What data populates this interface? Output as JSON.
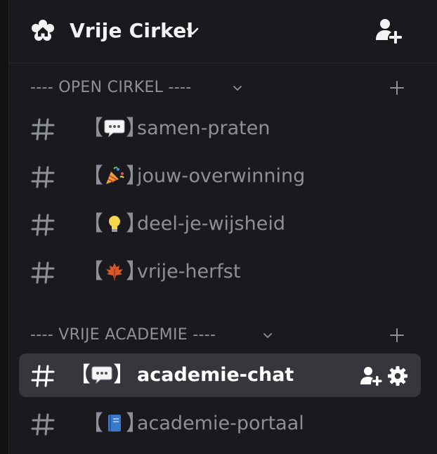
{
  "server": {
    "name": "Vrije Cirkel",
    "icon": "home-flower-icon",
    "chevron_icon": "chevron-down-icon",
    "invite_icon": "add-member-icon"
  },
  "categories": [
    {
      "label": "---- OPEN CIRKEL ----",
      "collapse_icon": "chevron-down-icon",
      "add_icon": "plus-icon",
      "channels": [
        {
          "name": "samen-praten",
          "emoji": "speech-bubble-icon",
          "open": "【",
          "close": "】"
        },
        {
          "name": "jouw-overwinning",
          "emoji": "party-popper-icon",
          "open": "【",
          "close": "】"
        },
        {
          "name": "deel-je-wijsheid",
          "emoji": "light-bulb-icon",
          "open": "【",
          "close": "】"
        },
        {
          "name": "vrije-herfst",
          "emoji": "maple-leaf-icon",
          "open": "【",
          "close": "】"
        }
      ]
    },
    {
      "label": "---- VRIJE ACADEMIE ----",
      "collapse_icon": "chevron-down-icon",
      "add_icon": "plus-icon",
      "channels": [
        {
          "name": "academie-chat",
          "emoji": "speech-bubble-icon",
          "open": "【",
          "close": "】",
          "active": true
        },
        {
          "name": "academie-portaal",
          "emoji": "blue-book-icon",
          "open": "【",
          "close": "】"
        }
      ]
    }
  ],
  "colors": {
    "background": "#1a1a1e",
    "active_row": "#35373d",
    "muted_text": "#8e9099",
    "header_text": "#f2f3f5",
    "active_text": "#ffffff"
  }
}
